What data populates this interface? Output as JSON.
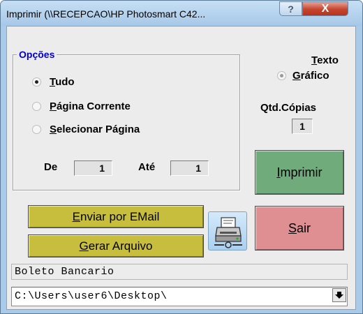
{
  "window": {
    "title": "Imprimir (\\\\RECEPCAO\\HP Photosmart C42...",
    "help_glyph": "?",
    "close_glyph": "X"
  },
  "options": {
    "legend": "Opções",
    "tudo_first": "T",
    "tudo_rest": "udo",
    "pagina_first": "P",
    "pagina_rest": "ágina Corrente",
    "selecionar_first": "S",
    "selecionar_rest": "elecionar Página",
    "selected": "Tudo"
  },
  "range": {
    "from_label": "De",
    "from_value": "1",
    "to_label": "Até",
    "to_value": "1"
  },
  "output_mode": {
    "texto_first": "T",
    "texto_rest": "exto",
    "grafico_first": "G",
    "grafico_rest": "ráfico",
    "selected": "Gráfico"
  },
  "copies": {
    "label": "Qtd.Cópias",
    "value": "1"
  },
  "buttons": {
    "imprimir_first": "I",
    "imprimir_rest": "mprimir",
    "sair_first": "S",
    "sair_rest": "air",
    "email_first": "E",
    "email_rest": "nviar por EMail",
    "gerar_first": "G",
    "gerar_rest": "erar Arquivo"
  },
  "status": {
    "document": "Boleto Bancario",
    "path": "C:\\Users\\user6\\Desktop\\"
  },
  "icons": {
    "printer": "printer-setup-icon",
    "dropdown": "down-arrow-icon"
  },
  "colors": {
    "imprimir": "#6fab7b",
    "sair": "#df8e92",
    "email": "#c8be3e",
    "legend": "#0000cc"
  }
}
